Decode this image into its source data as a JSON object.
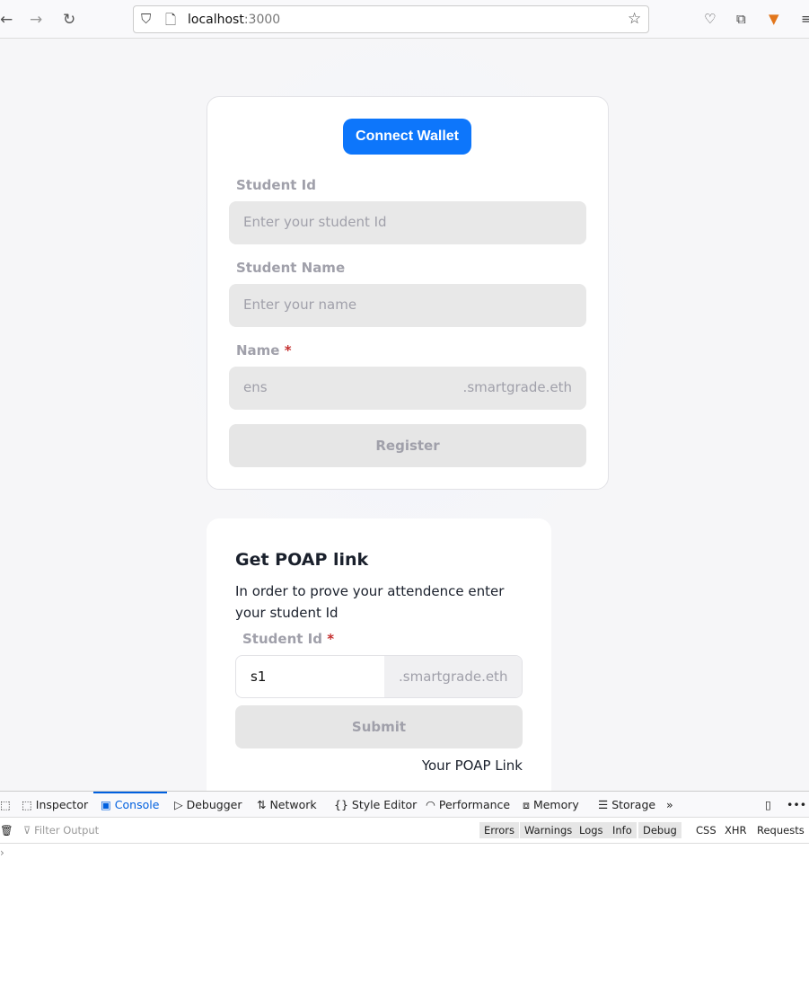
{
  "browser": {
    "url_host": "localhost",
    "url_port": ":3000",
    "icons": [
      "back-icon",
      "forward-icon",
      "reload-icon",
      "shield-icon",
      "page-icon",
      "star-icon",
      "pocket-icon",
      "extensions-icon",
      "metamask-icon",
      "menu-icon"
    ]
  },
  "register_card": {
    "connect_label": "Connect Wallet",
    "student_id_label": "Student Id",
    "student_id_placeholder": "Enter your student Id",
    "student_name_label": "Student Name",
    "student_name_placeholder": "Enter your name",
    "name_label": "Name",
    "required_mark": "*",
    "name_placeholder": "ens",
    "name_suffix": ".smartgrade.eth",
    "register_label": "Register"
  },
  "poap_card": {
    "title": "Get POAP link",
    "description": "In order to prove your attendence enter your student Id",
    "student_id_label": "Student Id",
    "required_mark": "*",
    "student_id_value": "s1",
    "suffix": ".smartgrade.eth",
    "submit_label": "Submit",
    "poap_link": "Your POAP Link"
  },
  "devtools": {
    "tabs": [
      "Inspector",
      "Console",
      "Debugger",
      "Network",
      "Style Editor",
      "Performance",
      "Memory",
      "Storage"
    ],
    "active_tab": "Console",
    "filter_placeholder": "Filter Output",
    "levels": [
      "Errors",
      "Warnings",
      "Logs",
      "Info",
      "Debug"
    ],
    "types": [
      "CSS",
      "XHR",
      "Requests"
    ],
    "accent": "#0060df"
  }
}
